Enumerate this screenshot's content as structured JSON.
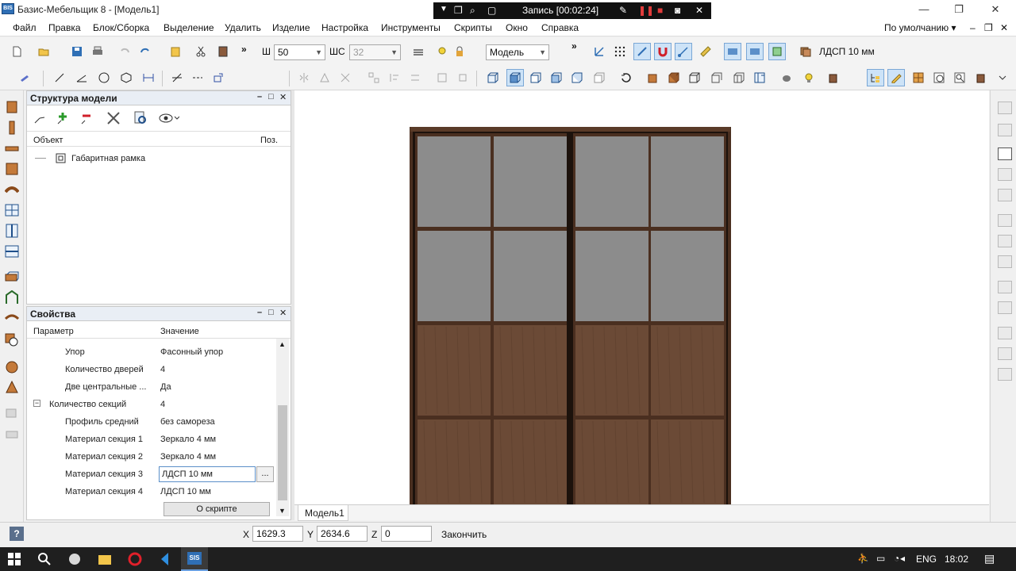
{
  "window": {
    "title": "Базис-Мебельщик 8 - [Модель1]",
    "app_icon_text": "BIS"
  },
  "recorder": {
    "label": "Запись [00:02:24]"
  },
  "menu": {
    "items": [
      "Файл",
      "Правка",
      "Блок/Сборка",
      "Выделение",
      "Удалить",
      "Изделие",
      "Настройка",
      "Инструменты",
      "Скрипты",
      "Окно",
      "Справка"
    ],
    "preset": "По умолчанию"
  },
  "toolbar": {
    "width_label": "Ш",
    "width_value": "50",
    "step_label": "ШС",
    "step_value": "32",
    "mode_value": "Модель",
    "material_value": "ЛДСП 10 мм",
    "accent": "#2f6fb5"
  },
  "structure": {
    "title": "Структура модели",
    "col_object": "Объект",
    "col_pos": "Поз.",
    "items": [
      "Габаритная рамка"
    ]
  },
  "properties": {
    "title": "Свойства",
    "col_param": "Параметр",
    "col_value": "Значение",
    "rows": [
      {
        "key": "Упор",
        "value": "Фасонный упор"
      },
      {
        "key": "Количество дверей",
        "value": "4"
      },
      {
        "key": "Две центральные ...",
        "value": "Да"
      },
      {
        "key": "Количество секций",
        "value": "4"
      },
      {
        "key": "Профиль средний",
        "value": "без самореза"
      },
      {
        "key": "Материал секция 1",
        "value": "Зеркало 4 мм"
      },
      {
        "key": "Материал секция 2",
        "value": "Зеркало 4 мм"
      },
      {
        "key": "Материал секция 3",
        "value": "ЛДСП 10 мм"
      },
      {
        "key": "Материал секция 4",
        "value": "ЛДСП 10 мм"
      }
    ],
    "browse_label": "...",
    "script_button": "О скрипте"
  },
  "viewport": {
    "tab": "Модель1",
    "colors": {
      "frame": "#4a2f20",
      "glass": "#8c8c8c",
      "wood": "#6b4a36",
      "divider": "#1c120c"
    }
  },
  "status": {
    "x_label": "X",
    "x_value": "1629.3",
    "y_label": "Y",
    "y_value": "2634.6",
    "z_label": "Z",
    "z_value": "0",
    "finish": "Закончить"
  },
  "taskbar": {
    "lang": "ENG",
    "time": "18:02",
    "sis_label": "SIS"
  }
}
